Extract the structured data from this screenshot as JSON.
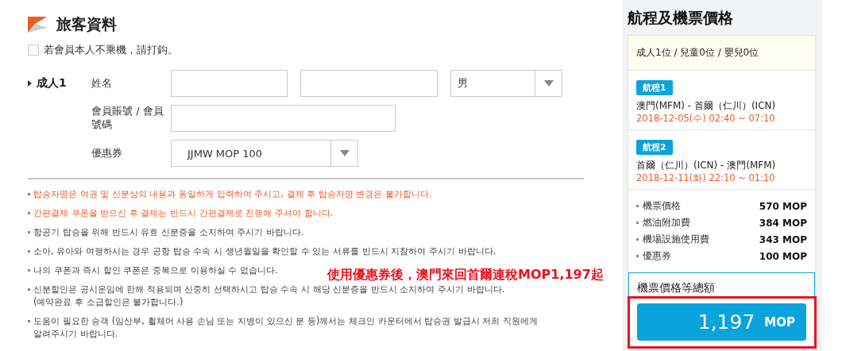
{
  "passenger_section": {
    "title": "旅客資料",
    "not_flying_checkbox": {
      "label": "若會員本人不乘機，請打鈎。",
      "checked": false
    },
    "passenger": {
      "label": "成人1",
      "name_label": "姓名",
      "gender": "男",
      "member_label": "會員賬號 / 會員號碼",
      "coupon_label": "優惠券",
      "coupon": "JJMW MOP 100"
    },
    "notes": [
      {
        "text": "탑승자명은 여권 및 신분상의 내용과 동일하게 입력하여 주시고, 결제 후 탑승자명 변경은 불가합니다.",
        "kind": "warning"
      },
      {
        "text": "간편결제 쿠폰을 받으신 후 결제는 반드시 간편결제로 진행해 주셔야 합니다.",
        "kind": "warning"
      },
      {
        "text": "항공기 탑승을 위해 반드시 유효 신분증을 소지하여 주시기 바랍니다.",
        "kind": "normal"
      },
      {
        "text": "소아, 유아와 여행하시는 경우 공항 탑승 수속 시 생년월일을 확인할 수 있는 서류를 반드시 지참하여 주시기 바랍니다.",
        "kind": "normal"
      },
      {
        "text": "나의 쿠폰과 즉시 할인 쿠폰은 중복으로 이용하실 수 없습니다.",
        "kind": "normal"
      },
      {
        "text": "신분할인은 공시운임에 한해 적용되며 신중히 선택하시고 탑승 수속 시 해당 신분증을 반드시 소지하여 주시기 바랍니다.",
        "sub": "(예약완료 후 소급할인은 불가합니다.)",
        "kind": "normal"
      },
      {
        "text": "도움이 필요한 승객 (임산부, 휠체어 사용 손님 또는 지병이 있으신 분 등)께서는 체크인 카운터에서 탑승권 발급시 저희 직원에게",
        "sub": "알려주시기 바랍니다.",
        "kind": "normal"
      }
    ]
  },
  "summary": {
    "title": "航程及機票價格",
    "passengers": "成人1位 / 兒童0位 / 嬰兒0位",
    "segments": [
      {
        "badge": "航程1",
        "route": "澳門(MFM) - 首爾（仁川）(ICN)",
        "time": "2018-12-05(수) 02:40 ~ 07:10"
      },
      {
        "badge": "航程2",
        "route": "首爾（仁川）(ICN) - 澳門(MFM)",
        "time": "2018-12-11(화) 22:10 ~ 01:10"
      }
    ],
    "fares": [
      {
        "label": "機票價格",
        "amount": "570 MOP"
      },
      {
        "label": "燃油附加費",
        "amount": "384 MOP"
      },
      {
        "label": "機場設施使用費",
        "amount": "343 MOP"
      },
      {
        "label": "優惠券",
        "amount": "100 MOP"
      }
    ],
    "total_label": "機票價格等總額",
    "total": "1,197",
    "currency": "MOP"
  },
  "annotation": {
    "text": "使用優惠券後，澳門來回首爾連稅MOP1,197起"
  }
}
